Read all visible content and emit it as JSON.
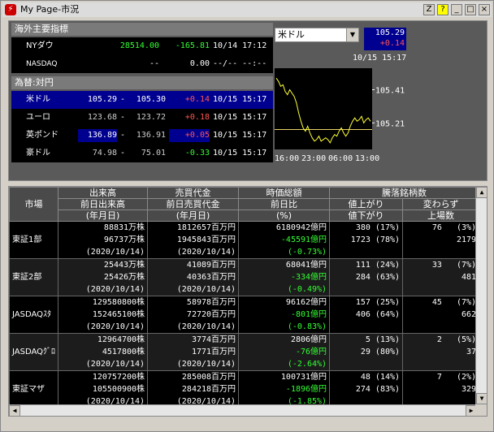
{
  "window": {
    "title": "My Page-市況",
    "buttons": [
      "Z",
      "?",
      "_",
      "□",
      "×"
    ]
  },
  "indices": {
    "header": "海外主要指標",
    "rows": [
      {
        "name": "NYダウ",
        "value": "28514.00",
        "change": "-165.81",
        "time": "10/14 17:12"
      },
      {
        "name": "NASDAQ",
        "value": "--",
        "change": "0.00",
        "time": "--/-- --:--"
      }
    ]
  },
  "fx": {
    "header": "為替:対円",
    "rows": [
      {
        "name": "米ドル",
        "bid": "105.29",
        "sep": "-",
        "ask": "105.30",
        "change": "+0.14",
        "time": "10/15 15:17"
      },
      {
        "name": "ユーロ",
        "bid": "123.68",
        "sep": "-",
        "ask": "123.72",
        "change": "+0.18",
        "time": "10/15 15:17"
      },
      {
        "name": "英ポンド",
        "bid": "136.89",
        "sep": "-",
        "ask": "136.91",
        "change": "+0.05",
        "time": "10/15 15:17"
      },
      {
        "name": "豪ドル",
        "bid": "74.98",
        "sep": "-",
        "ask": "75.01",
        "change": "-0.33",
        "time": "10/15 15:17"
      }
    ]
  },
  "mini_chart": {
    "selected": "米ドル",
    "price": "105.29",
    "change": "+0.14",
    "time": "10/15 15:17",
    "y_ticks": [
      "105.41",
      "105.21"
    ],
    "x_ticks": [
      "16:00",
      "23:00",
      "06:00",
      "13:00"
    ]
  },
  "chart_data": {
    "type": "line",
    "title": "",
    "xlabel": "",
    "ylabel": "",
    "x_ticks": [
      "16:00",
      "23:00",
      "06:00",
      "13:00"
    ],
    "ylim": [
      105.06,
      105.53
    ],
    "series": [
      {
        "values": [
          105.48,
          105.46,
          105.43,
          105.44,
          105.4,
          105.38,
          105.41,
          105.39,
          105.37,
          105.33,
          105.27,
          105.22,
          105.18,
          105.16,
          105.19,
          105.15,
          105.12,
          105.1,
          105.11,
          105.13,
          105.1,
          105.11,
          105.12,
          105.11,
          105.09,
          105.12,
          105.14,
          105.13,
          105.16,
          105.18,
          105.15,
          105.13,
          105.15,
          105.19,
          105.22,
          105.24,
          105.22,
          105.23,
          105.25,
          105.21,
          105.23,
          105.24,
          105.22
        ]
      }
    ],
    "reference_line": 105.17
  },
  "market_table": {
    "headers": {
      "market": "市場",
      "volume": [
        "出来高",
        "前日出来高",
        "(年月日)"
      ],
      "value": [
        "売買代金",
        "前日売買代金",
        "(年月日)"
      ],
      "cap": [
        "時価総額",
        "前日比",
        "(%)"
      ],
      "breadth": "騰落銘柄数",
      "up_down": [
        "値上がり",
        "値下がり"
      ],
      "unch": [
        "変わらず",
        "上場数"
      ]
    },
    "rows": [
      {
        "market": "東証1部",
        "vol": "88831万株",
        "pvol": "96737万株",
        "date1": "(2020/10/14)",
        "val": "1812657百万円",
        "pval": "1945843百万円",
        "date2": "(2020/10/14)",
        "cap": "6180942億円",
        "capchg": "-45591億円",
        "cappct": "(-0.73%)",
        "up": "380",
        "uppct": "(17%)",
        "down": "1723",
        "downpct": "(78%)",
        "unch": "76",
        "unchpct": "(3%)",
        "listed": "2179"
      },
      {
        "market": "東証2部",
        "vol": "25443万株",
        "pvol": "25426万株",
        "date1": "(2020/10/14)",
        "val": "41089百万円",
        "pval": "40363百万円",
        "date2": "(2020/10/14)",
        "cap": "68041億円",
        "capchg": "-334億円",
        "cappct": "(-0.49%)",
        "up": "111",
        "uppct": "(24%)",
        "down": "284",
        "downpct": "(63%)",
        "unch": "33",
        "unchpct": "(7%)",
        "listed": "481"
      },
      {
        "market": "JASDAQｽﾀ",
        "vol": "129580800株",
        "pvol": "152465100株",
        "date1": "(2020/10/14)",
        "val": "58978百万円",
        "pval": "72720百万円",
        "date2": "(2020/10/14)",
        "cap": "96162億円",
        "capchg": "-801億円",
        "cappct": "(-0.83%)",
        "up": "157",
        "uppct": "(25%)",
        "down": "406",
        "downpct": "(64%)",
        "unch": "45",
        "unchpct": "(7%)",
        "listed": "662"
      },
      {
        "market": "JASDAQｸﾞﾛ",
        "vol": "12964700株",
        "pvol": "4517800株",
        "date1": "(2020/10/14)",
        "val": "3774百万円",
        "pval": "1771百万円",
        "date2": "(2020/10/14)",
        "cap": "2806億円",
        "capchg": "-76億円",
        "cappct": "(-2.64%)",
        "up": "5",
        "uppct": "(13%)",
        "down": "29",
        "downpct": "(80%)",
        "unch": "2",
        "unchpct": "(5%)",
        "listed": "37"
      },
      {
        "market": "東証マザ",
        "vol": "120757200株",
        "pvol": "105500900株",
        "date1": "(2020/10/14)",
        "val": "285008百万円",
        "pval": "284218百万円",
        "date2": "(2020/10/14)",
        "cap": "100731億円",
        "capchg": "-1896億円",
        "cappct": "(-1.85%)",
        "up": "48",
        "uppct": "(14%)",
        "down": "274",
        "downpct": "(83%)",
        "unch": "7",
        "unchpct": "(2%)",
        "listed": "329"
      }
    ]
  },
  "colors": {
    "up": "#ff5555",
    "down": "#33ff33",
    "highlight": "#000090",
    "panel": "#5a5a5a"
  }
}
